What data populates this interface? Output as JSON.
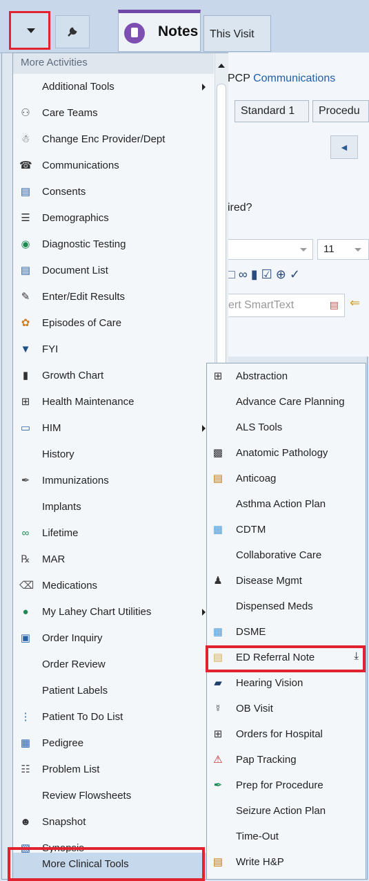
{
  "toolbar": {
    "notes_tab": "Notes",
    "visit_tab": "This Visit"
  },
  "background": {
    "line1_prefix": "PCP",
    "line1_link": "Communications",
    "btn_standard": "Standard 1",
    "btn_procedure": "Procedu",
    "question": "ired?",
    "font_size": "11",
    "smarttext_placeholder": "ert SmartText"
  },
  "menu": {
    "header": "More Activities",
    "items": [
      {
        "label": "Additional Tools",
        "icon": "",
        "submenu": true
      },
      {
        "label": "Care Teams",
        "icon": "care-teams-icon"
      },
      {
        "label": "Change Enc Provider/Dept",
        "icon": "change-provider-icon"
      },
      {
        "label": "Communications",
        "icon": "communications-icon"
      },
      {
        "label": "Consents",
        "icon": "consents-icon"
      },
      {
        "label": "Demographics",
        "icon": "demographics-icon"
      },
      {
        "label": "Diagnostic Testing",
        "icon": "camera-icon"
      },
      {
        "label": "Document List",
        "icon": "document-list-icon"
      },
      {
        "label": "Enter/Edit Results",
        "icon": "pencil-icon"
      },
      {
        "label": "Episodes of Care",
        "icon": "episodes-icon"
      },
      {
        "label": "FYI",
        "icon": "flag-icon"
      },
      {
        "label": "Growth Chart",
        "icon": "growth-chart-icon"
      },
      {
        "label": "Health Maintenance",
        "icon": "health-maintenance-icon"
      },
      {
        "label": "HIM",
        "icon": "him-icon",
        "submenu": true
      },
      {
        "label": "History",
        "icon": ""
      },
      {
        "label": "Immunizations",
        "icon": "syringe-icon"
      },
      {
        "label": "Implants",
        "icon": ""
      },
      {
        "label": "Lifetime",
        "icon": "lifetime-icon"
      },
      {
        "label": "MAR",
        "icon": "mar-icon"
      },
      {
        "label": "Medications",
        "icon": "medications-icon"
      },
      {
        "label": "My Lahey Chart Utilities",
        "icon": "globe-icon",
        "submenu": true
      },
      {
        "label": "Order Inquiry",
        "icon": "order-inquiry-icon"
      },
      {
        "label": "Order Review",
        "icon": ""
      },
      {
        "label": "Patient Labels",
        "icon": ""
      },
      {
        "label": "Patient To Do List",
        "icon": "todo-list-icon"
      },
      {
        "label": "Pedigree",
        "icon": "pedigree-icon"
      },
      {
        "label": "Problem List",
        "icon": "problem-list-icon"
      },
      {
        "label": "Review Flowsheets",
        "icon": ""
      },
      {
        "label": "Snapshot",
        "icon": "person-icon"
      },
      {
        "label": "Synopsis",
        "icon": "synopsis-icon"
      },
      {
        "label": "More Clinical Tools",
        "icon": "",
        "selected": true
      }
    ]
  },
  "submenu": {
    "items": [
      {
        "label": "Abstraction",
        "icon": "plus-box-icon"
      },
      {
        "label": "Advance Care Planning",
        "icon": ""
      },
      {
        "label": "ALS Tools",
        "icon": ""
      },
      {
        "label": "Anatomic Pathology",
        "icon": "pathology-icon"
      },
      {
        "label": "Anticoag",
        "icon": "clipboard-icon"
      },
      {
        "label": "Asthma Action Plan",
        "icon": ""
      },
      {
        "label": "CDTM",
        "icon": "cdtm-icon"
      },
      {
        "label": "Collaborative Care",
        "icon": ""
      },
      {
        "label": "Disease Mgmt",
        "icon": "group-icon"
      },
      {
        "label": "Dispensed Meds",
        "icon": ""
      },
      {
        "label": "DSME",
        "icon": "dsme-icon"
      },
      {
        "label": "ED Referral Note",
        "icon": "note-icon",
        "pinned": true
      },
      {
        "label": "Hearing Vision",
        "icon": "binoculars-icon"
      },
      {
        "label": "OB Visit",
        "icon": "ob-visit-icon"
      },
      {
        "label": "Orders for Hospital",
        "icon": "plus-box-icon"
      },
      {
        "label": "Pap Tracking",
        "icon": "alert-clipboard-icon"
      },
      {
        "label": "Prep for Procedure",
        "icon": "prep-icon"
      },
      {
        "label": "Seizure Action Plan",
        "icon": ""
      },
      {
        "label": "Time-Out",
        "icon": ""
      },
      {
        "label": "Write H&P",
        "icon": "write-hp-icon"
      }
    ]
  }
}
